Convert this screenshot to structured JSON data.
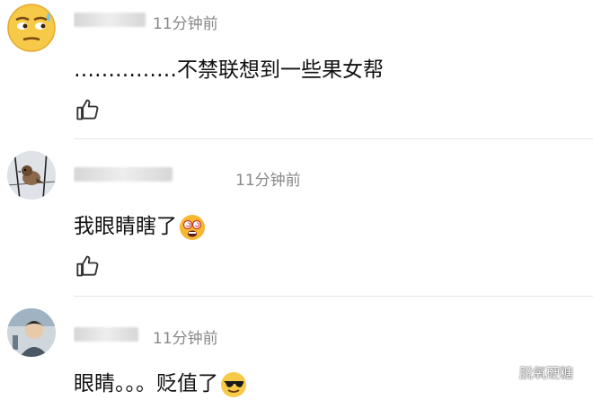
{
  "comments": [
    {
      "time": "11分钟前",
      "text": "……………不禁联想到一些果女帮"
    },
    {
      "time": "11分钟前",
      "text": "我眼睛瞎了"
    },
    {
      "time": "11分钟前",
      "text": "眼睛。。。贬值了"
    }
  ],
  "watermark": "脱氧硬糖",
  "icons": [
    "smirk-emoji-icon",
    "thumbs-up-icon",
    "dizzy-face-emoji-icon",
    "sunglasses-emoji-icon",
    "wechat-icon"
  ]
}
